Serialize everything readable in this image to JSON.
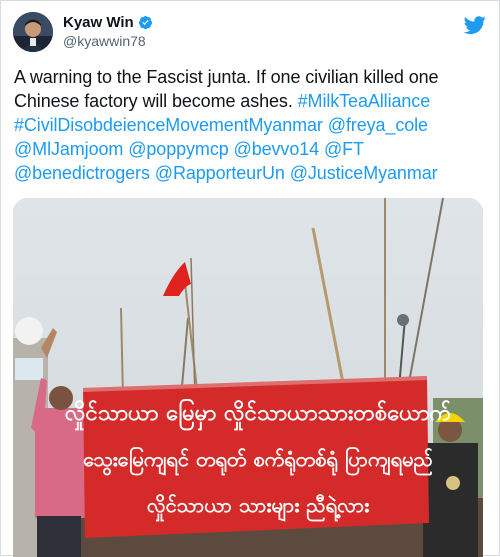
{
  "author": {
    "display_name": "Kyaw Win",
    "handle": "@kyawwin78",
    "verified": true
  },
  "icons": {
    "verified": "verified-badge-icon",
    "brand": "twitter-bird-icon"
  },
  "tweet": {
    "text_plain": "A warning to the Fascist junta. If one civilian killed one Chinese factory will become ashes.",
    "links": [
      "#MilkTeaAlliance",
      "#CivilDisobdeienceMovementMyanmar",
      "@freya_cole",
      "@MlJamjoom",
      "@poppymcp",
      "@bevvo14",
      "@FT",
      "@benedictrogers",
      "@RapporteurUn",
      "@JusticeMyanmar"
    ]
  },
  "media": {
    "banner_lines": [
      "လှိုင်သာယာ မြေမှာ လှိုင်သာယာသားတစ်ယောက်",
      "သွေးမြေကျရင် တရုတ် စက်ရုံတစ်ရုံ ပြာကျရမည်",
      "လှိုင်သာယာ သားများ ညီရဲ့လား"
    ]
  },
  "colors": {
    "link": "#1d9bf0",
    "text": "#0f1419",
    "secondary": "#536471",
    "banner_red": "#d42a2a",
    "flag_red": "#e0221f"
  }
}
